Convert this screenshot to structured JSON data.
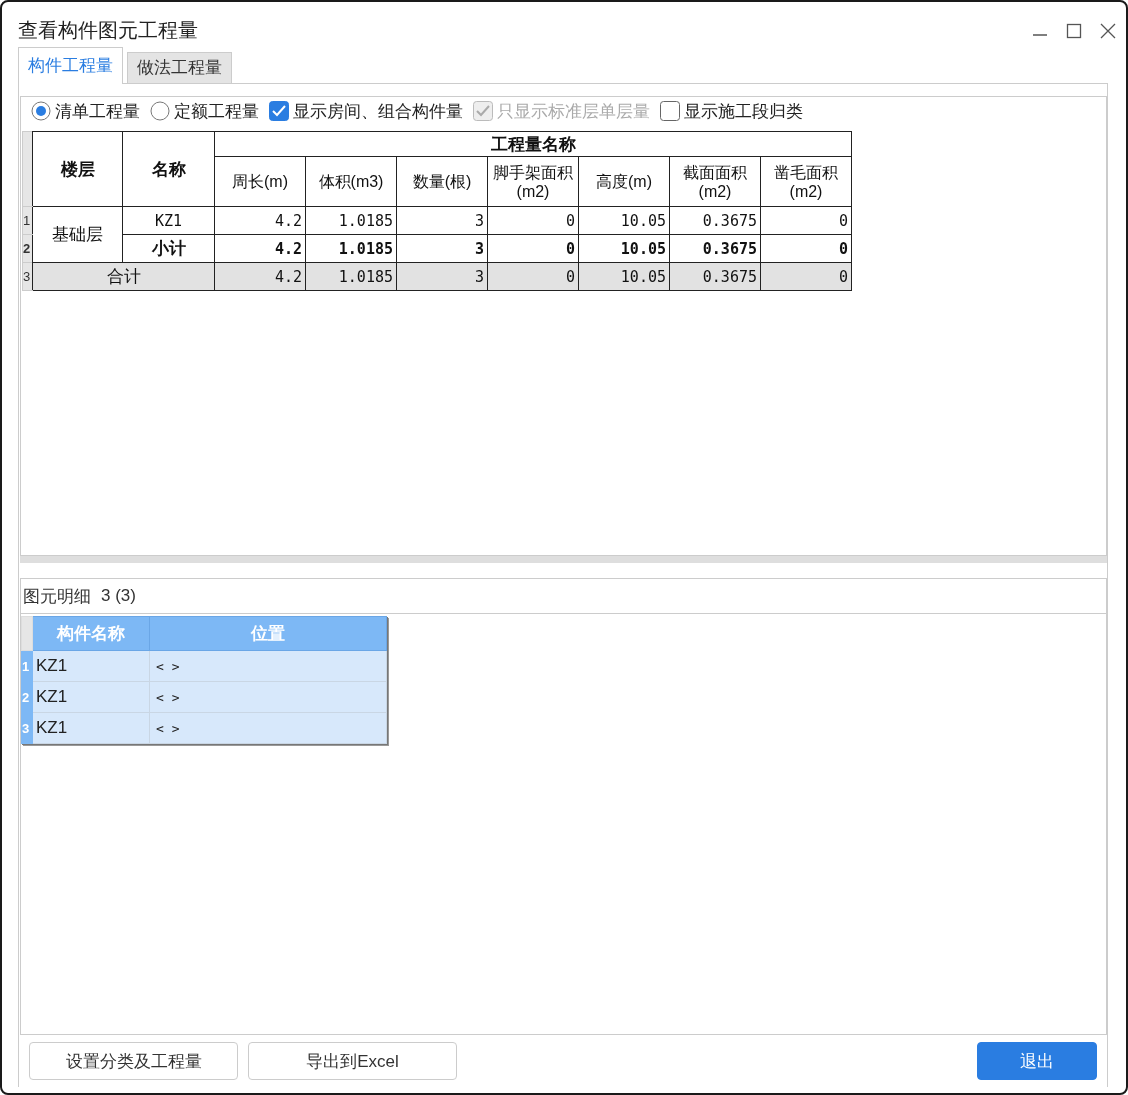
{
  "window": {
    "title": "查看构件图元工程量"
  },
  "tabs": [
    {
      "label": "构件工程量",
      "selected": true
    },
    {
      "label": "做法工程量",
      "selected": false
    }
  ],
  "options": [
    {
      "kind": "radio",
      "label": "清单工程量",
      "selected": true
    },
    {
      "kind": "radio",
      "label": "定额工程量",
      "selected": false
    },
    {
      "kind": "checkbox",
      "label": "显示房间、组合构件量",
      "checked": true,
      "disabled": false
    },
    {
      "kind": "checkbox",
      "label": "只显示标准层单层量",
      "checked": true,
      "disabled": true
    },
    {
      "kind": "checkbox",
      "label": "显示施工段归类",
      "checked": false,
      "disabled": false
    }
  ],
  "quantity_table": {
    "columns": [
      "楼层",
      "名称"
    ],
    "group_header": "工程量名称",
    "quantity_columns": [
      "周长(m)",
      "体积(m3)",
      "数量(根)",
      "脚手架面积(m2)",
      "高度(m)",
      "截面面积(m2)",
      "凿毛面积(m2)"
    ],
    "groups": [
      {
        "floor": "基础层",
        "rows": [
          {
            "number": "1",
            "kind": "item",
            "name": "KZ1",
            "values": [
              "4.2",
              "1.0185",
              "3",
              "0",
              "10.05",
              "0.3675",
              "0"
            ]
          },
          {
            "number": "2",
            "kind": "subtotal",
            "name": "小计",
            "values": [
              "4.2",
              "1.0185",
              "3",
              "0",
              "10.05",
              "0.3675",
              "0"
            ]
          }
        ]
      }
    ],
    "total": {
      "number": "3",
      "label": "合计",
      "values": [
        "4.2",
        "1.0185",
        "3",
        "0",
        "10.05",
        "0.3675",
        "0"
      ]
    }
  },
  "detail": {
    "title": "图元明细",
    "count": "3 (3)",
    "columns": [
      "构件名称",
      "位置"
    ],
    "rows": [
      {
        "number": "1",
        "name": "KZ1",
        "position": "< >"
      },
      {
        "number": "2",
        "name": "KZ1",
        "position": "< >"
      },
      {
        "number": "3",
        "name": "KZ1",
        "position": "< >"
      }
    ]
  },
  "buttons": [
    {
      "label": "设置分类及工程量",
      "kind": "default"
    },
    {
      "label": "导出到Excel",
      "kind": "default"
    },
    {
      "label": "退出",
      "kind": "primary"
    }
  ]
}
